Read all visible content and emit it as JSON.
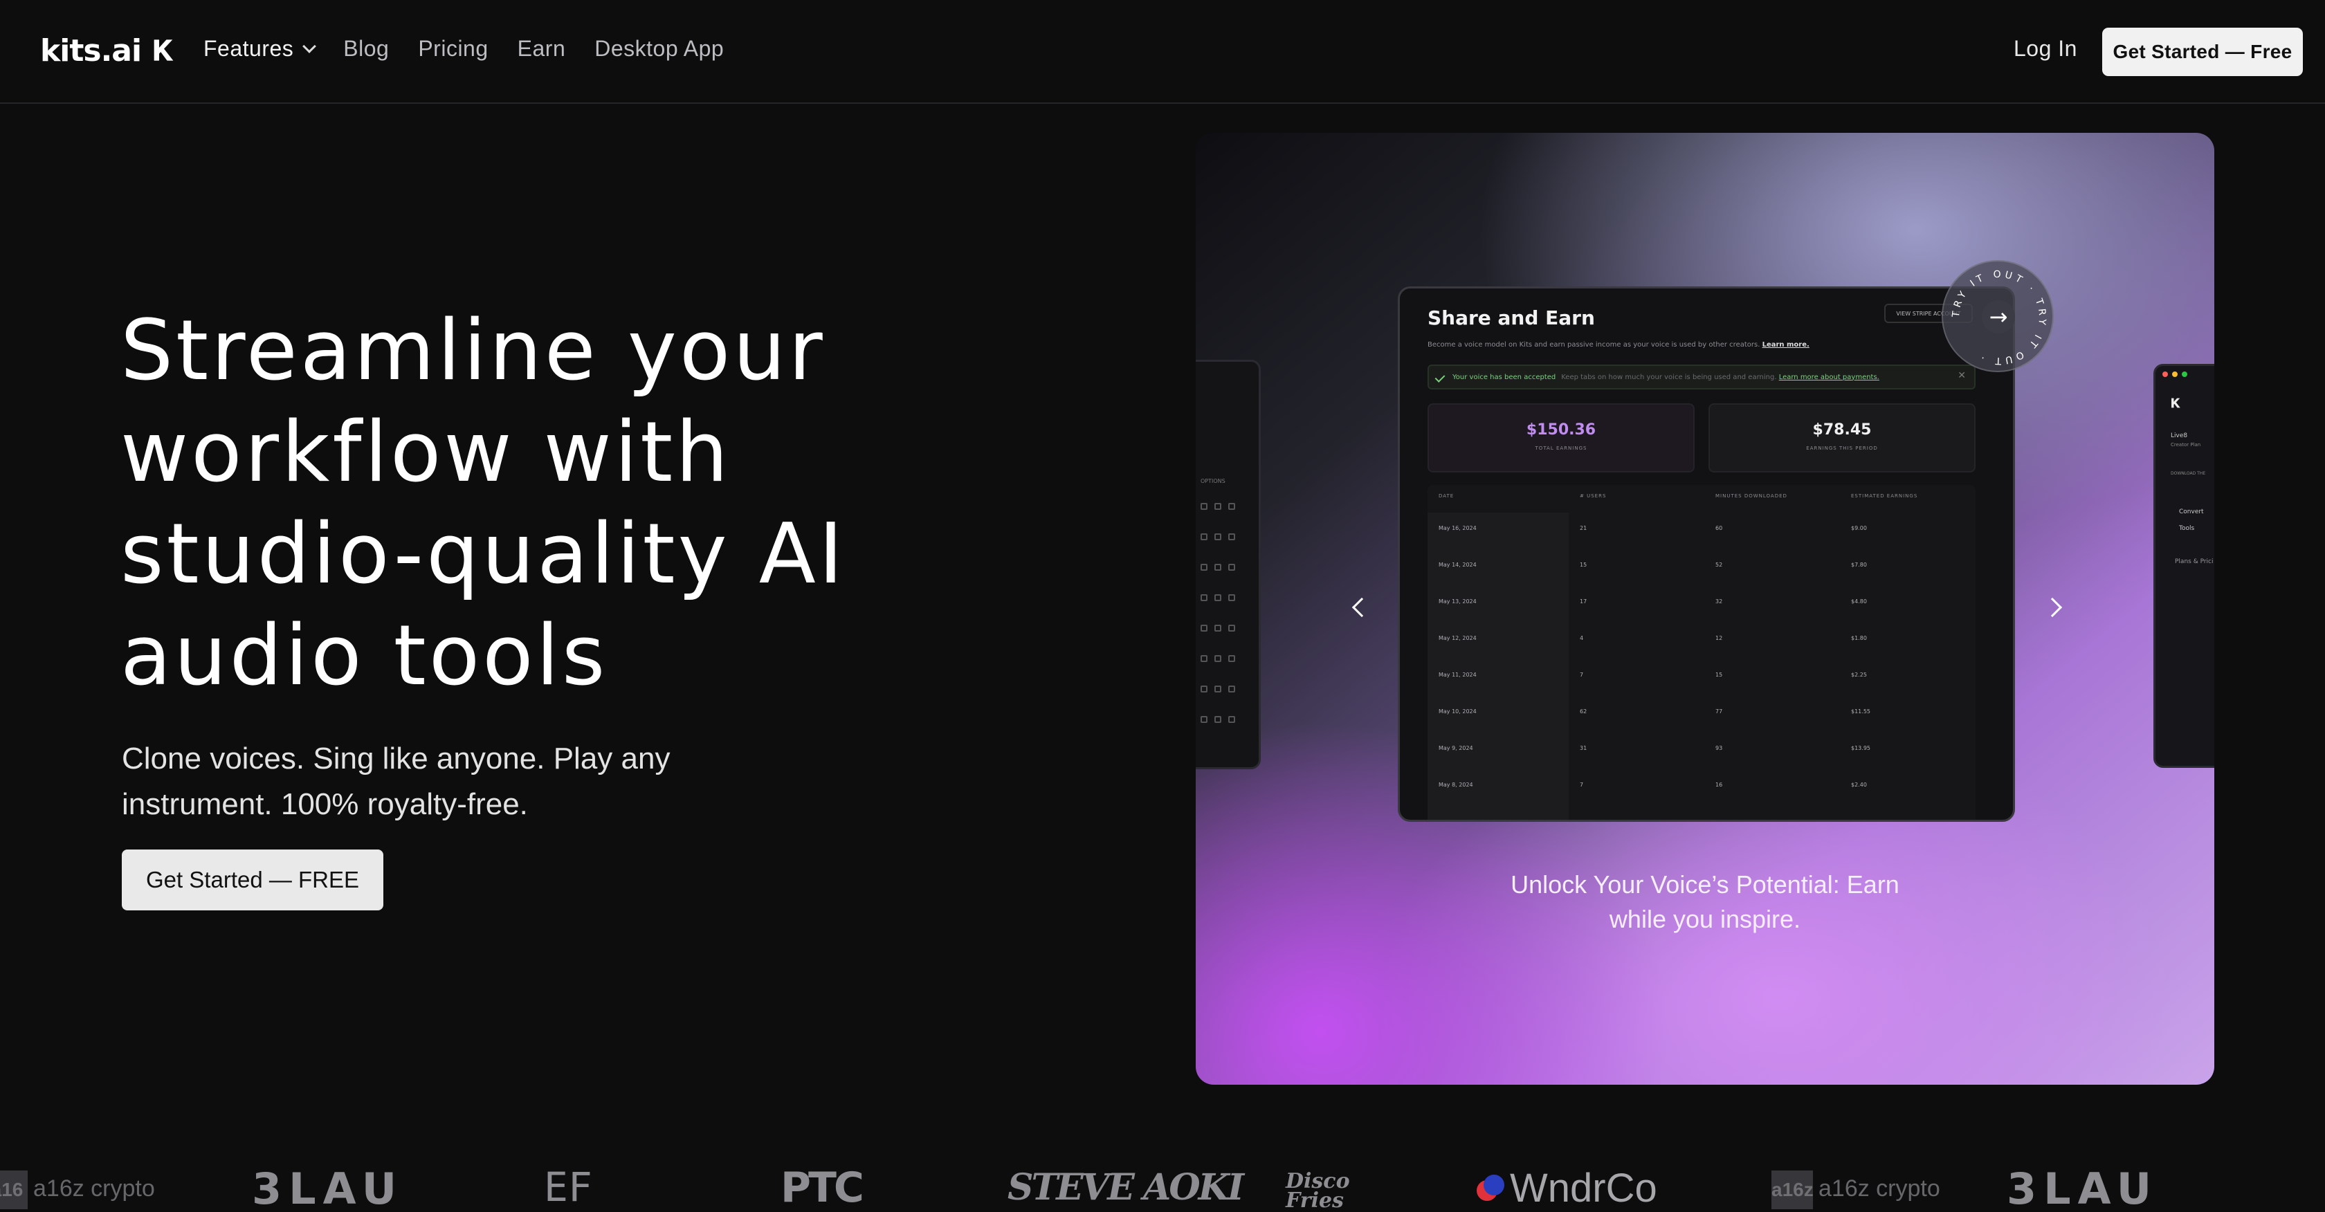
{
  "nav": {
    "logo_text": "kits.ai",
    "logo_mark": "𝐊",
    "links": [
      "Features",
      "Blog",
      "Pricing",
      "Earn",
      "Desktop App"
    ],
    "login": "Log In",
    "cta": "Get Started — Free"
  },
  "hero": {
    "title": "Streamline your\nworkflow with\nstudio-quality AI\naudio tools",
    "subtitle": "Clone voices. Sing like anyone. Play any\ninstrument.  100% royalty-free.",
    "cta": "Get Started — FREE"
  },
  "carousel": {
    "caption": "Unlock Your Voice’s Potential: Earn\nwhile you inspire.",
    "try_badge": "TRY IT OUT · TRY IT OUT ·",
    "screenshot": {
      "title": "Share and Earn",
      "description": "Become a voice model on Kits and earn passive income as your voice is used by other creators.",
      "description_link": "Learn more.",
      "button": "VIEW STRIPE ACCOUNT",
      "alert_title": "Your voice has been accepted",
      "alert_message": "Keep tabs on how much your voice is being used and earning.",
      "alert_link": "Learn more about payments.",
      "stats": [
        {
          "value": "$150.36",
          "label": "TOTAL EARNINGS"
        },
        {
          "value": "$78.45",
          "label": "EARNINGS THIS PERIOD"
        }
      ],
      "columns": [
        "DATE",
        "# USERS",
        "MINUTES DOWNLOADED",
        "ESTIMATED EARNINGS"
      ],
      "rows": [
        [
          "May 16, 2024",
          "21",
          "60",
          "$9.00"
        ],
        [
          "May 14, 2024",
          "15",
          "52",
          "$7.80"
        ],
        [
          "May 13, 2024",
          "17",
          "32",
          "$4.80"
        ],
        [
          "May 12, 2024",
          "4",
          "12",
          "$1.80"
        ],
        [
          "May 11, 2024",
          "7",
          "15",
          "$2.25"
        ],
        [
          "May 10, 2024",
          "62",
          "77",
          "$11.55"
        ],
        [
          "May 9, 2024",
          "31",
          "93",
          "$13.95"
        ],
        [
          "May 8, 2024",
          "7",
          "16",
          "$2.40"
        ]
      ]
    },
    "left_preview": {
      "label": "OPTIONS"
    },
    "right_preview": {
      "items": [
        "Live8",
        "Creator Plan",
        "DOWNLOAD THE",
        "Convert",
        "Tools",
        "Plans & Prici"
      ]
    }
  },
  "logos": {
    "brands": [
      "a16z crypto",
      "3LAU",
      "EF",
      "PTC",
      "STEVE AOKI",
      "Disco Fries",
      "WndrCo",
      "a16z crypto",
      "3LAU"
    ]
  },
  "colors": {
    "background": "#0d0d0e",
    "accent_purple": "#c08cf0",
    "success_green": "#79d37c"
  },
  "icons": [
    "chevron-down-icon",
    "chevron-left-icon",
    "chevron-right-icon",
    "arrow-right-icon",
    "check-icon",
    "close-icon"
  ]
}
